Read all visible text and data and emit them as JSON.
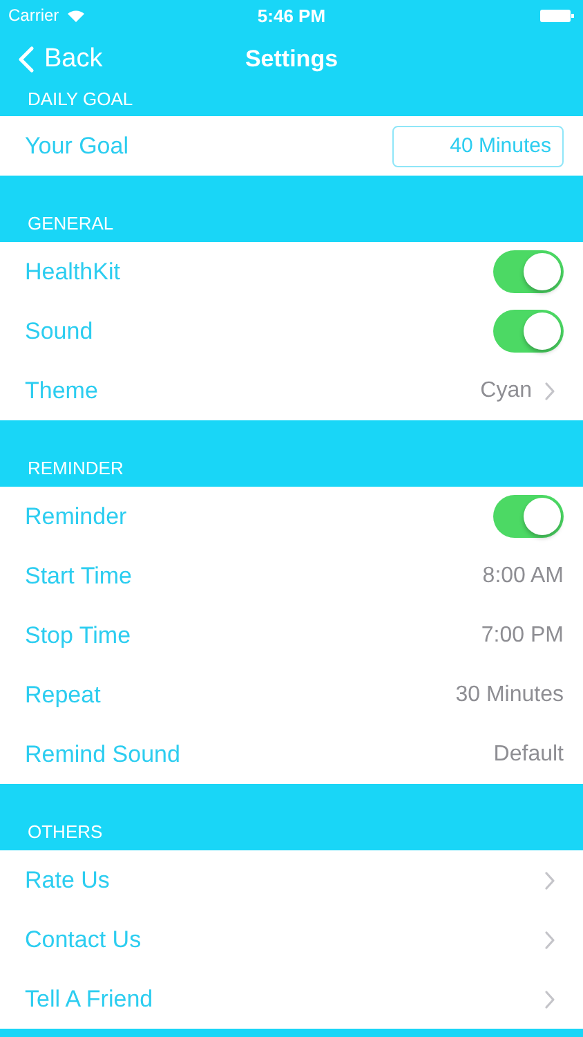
{
  "status_bar": {
    "carrier": "Carrier",
    "time": "5:46 PM"
  },
  "nav": {
    "back": "Back",
    "title": "Settings"
  },
  "sections": [
    {
      "header": "DAILY GOAL",
      "rows": [
        {
          "kind": "field",
          "label": "Your Goal",
          "value": "40 Minutes"
        }
      ]
    },
    {
      "header": "GENERAL",
      "rows": [
        {
          "kind": "toggle",
          "label": "HealthKit",
          "on": true
        },
        {
          "kind": "toggle",
          "label": "Sound",
          "on": true
        },
        {
          "kind": "link",
          "label": "Theme",
          "value": "Cyan"
        }
      ]
    },
    {
      "header": "REMINDER",
      "rows": [
        {
          "kind": "toggle",
          "label": "Reminder",
          "on": true
        },
        {
          "kind": "value",
          "label": "Start Time",
          "value": "8:00 AM"
        },
        {
          "kind": "value",
          "label": "Stop Time",
          "value": "7:00 PM"
        },
        {
          "kind": "value",
          "label": "Repeat",
          "value": "30 Minutes"
        },
        {
          "kind": "value",
          "label": "Remind Sound",
          "value": "Default"
        }
      ]
    },
    {
      "header": "OTHERS",
      "rows": [
        {
          "kind": "link",
          "label": "Rate Us"
        },
        {
          "kind": "link",
          "label": "Contact Us"
        },
        {
          "kind": "link",
          "label": "Tell A Friend"
        }
      ]
    }
  ]
}
